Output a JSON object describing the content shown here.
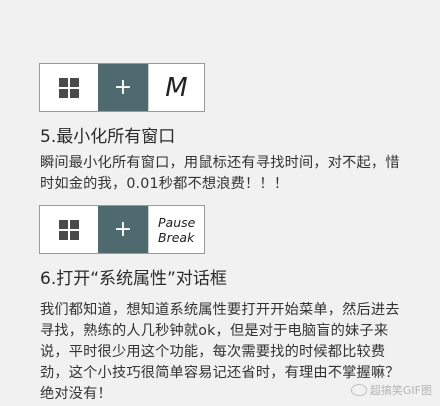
{
  "sections": [
    {
      "keys": {
        "win_icon": "windows-icon",
        "plus": "+",
        "key": "M"
      },
      "heading": "5.最小化所有窗口",
      "text": "瞬间最小化所有窗口，用鼠标还有寻找时间，对不起，惜时如金的我，0.01秒都不想浪费！！！"
    },
    {
      "keys": {
        "win_icon": "windows-icon",
        "plus": "+",
        "key_line1": "Pause",
        "key_line2": "Break"
      },
      "heading": "6.打开“系统属性”对话框",
      "text": "我们都知道，想知道系统属性要打开开始菜单，然后进去寻找，熟练的人几秒钟就ok，但是对于电脑盲的妹子来说，平时很少用这个功能，每次需要找的时候都比较费劲，这个小技巧很简单容易记还省时，有理由不掌握嘛？绝对没有！"
    }
  ],
  "watermark": "超搞笑GIF图",
  "colors": {
    "plus_key_bg": "#4e6a6f",
    "background": "#f1f1f1"
  }
}
